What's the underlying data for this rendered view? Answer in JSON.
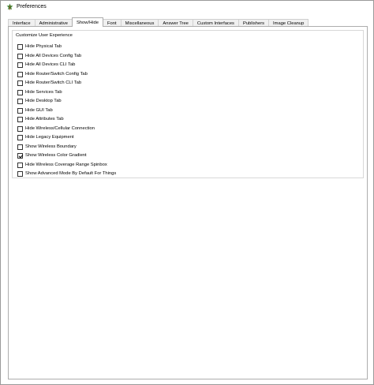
{
  "window": {
    "title": "Preferences",
    "icon": "packet-tracer-app-icon"
  },
  "tabs": [
    {
      "label": "Interface",
      "active": false
    },
    {
      "label": "Administrative",
      "active": false
    },
    {
      "label": "Show/Hide",
      "active": true
    },
    {
      "label": "Font",
      "active": false
    },
    {
      "label": "Miscellaneous",
      "active": false
    },
    {
      "label": "Answer Tree",
      "active": false
    },
    {
      "label": "Custom Interfaces",
      "active": false
    },
    {
      "label": "Publishers",
      "active": false
    },
    {
      "label": "Image Cleanup",
      "active": false
    }
  ],
  "group": {
    "title": "Customize User Experience",
    "options": [
      {
        "label": "Hide Physical Tab",
        "checked": false
      },
      {
        "label": "Hide All Devices Config Tab",
        "checked": false
      },
      {
        "label": "Hide All Devices CLI Tab",
        "checked": false
      },
      {
        "label": "Hide Router/Switch Config Tab",
        "checked": false
      },
      {
        "label": "Hide Router/Switch CLI Tab",
        "checked": false
      },
      {
        "label": "Hide Services Tab",
        "checked": false
      },
      {
        "label": "Hide Desktop Tab",
        "checked": false
      },
      {
        "label": "Hide GUI Tab",
        "checked": false
      },
      {
        "label": "Hide Attributes Tab",
        "checked": false
      },
      {
        "label": "Hide Wireless/Cellular Connection",
        "checked": false
      },
      {
        "label": "Hide Legacy Equipment",
        "checked": false
      },
      {
        "label": "Show Wireless Boundary",
        "checked": false
      },
      {
        "label": "Show Wireless Color Gradient",
        "checked": true
      },
      {
        "label": "Hide Wireless Coverage Range Spinbox",
        "checked": false
      },
      {
        "label": "Show Advanced Mode By Default For Things",
        "checked": false
      }
    ]
  }
}
